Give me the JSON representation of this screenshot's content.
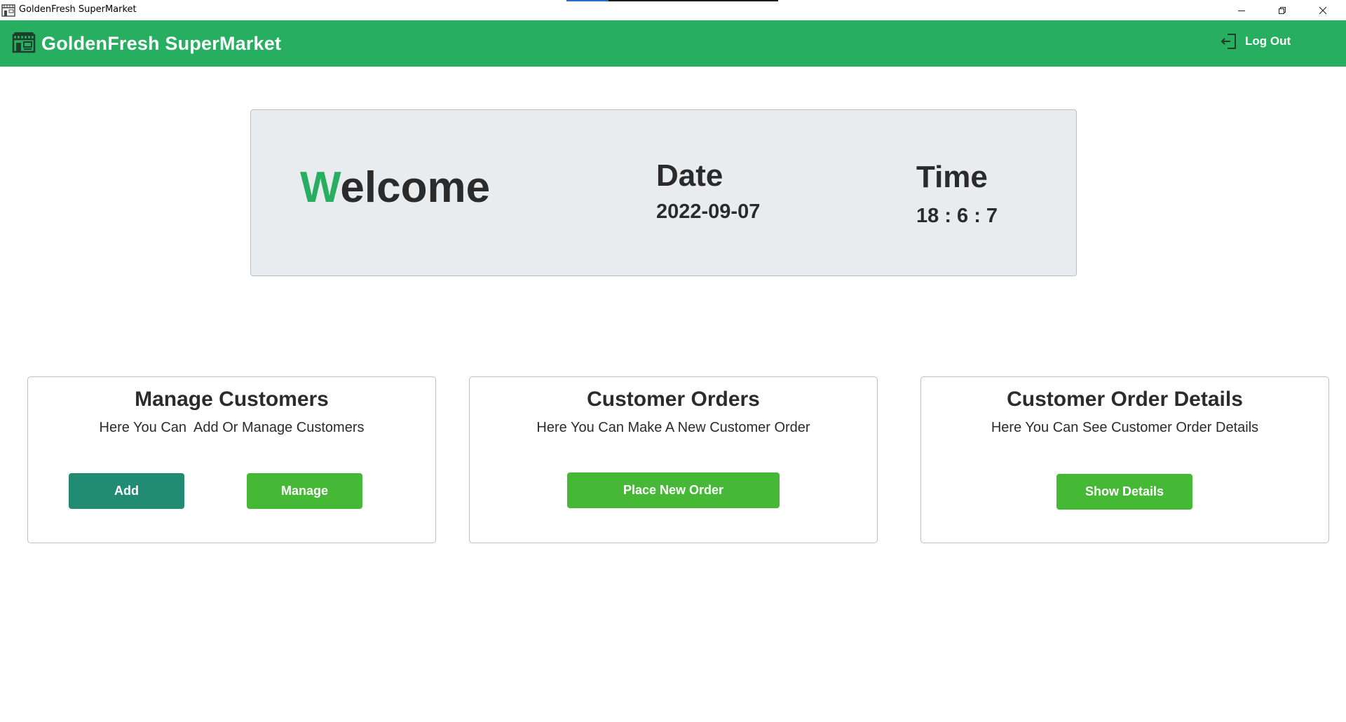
{
  "window": {
    "title": "GoldenFresh SuperMarket",
    "icons": [
      "storefront-icon",
      "minimize-icon",
      "restore-icon",
      "close-icon"
    ]
  },
  "header": {
    "brand": "GoldenFresh SuperMarket",
    "logout_label": "Log Out",
    "color": "#27ae60",
    "icons": [
      "storefront-icon",
      "logout-icon"
    ]
  },
  "welcome_panel": {
    "welcome_first_letter": "W",
    "welcome_rest": "elcome",
    "date_title": "Date",
    "date_value": "2022-09-07",
    "time_title": "Time",
    "time_value": "18 : 6 : 7"
  },
  "cards": [
    {
      "title": "Manage Customers",
      "subtitle": "Here You Can  Add Or Manage Customers",
      "buttons": [
        "Add",
        "Manage"
      ]
    },
    {
      "title": "Customer Orders",
      "subtitle": "Here You Can Make A New Customer Order",
      "buttons": [
        "Place New Order"
      ]
    },
    {
      "title": "Customer Order Details",
      "subtitle": "Here You Can See Customer Order Details",
      "buttons": [
        "Show Details"
      ]
    }
  ],
  "colors": {
    "accent_green": "#27ae60",
    "button_green": "#45b935",
    "button_teal": "#218b74",
    "panel_bg": "#e8ecef"
  }
}
